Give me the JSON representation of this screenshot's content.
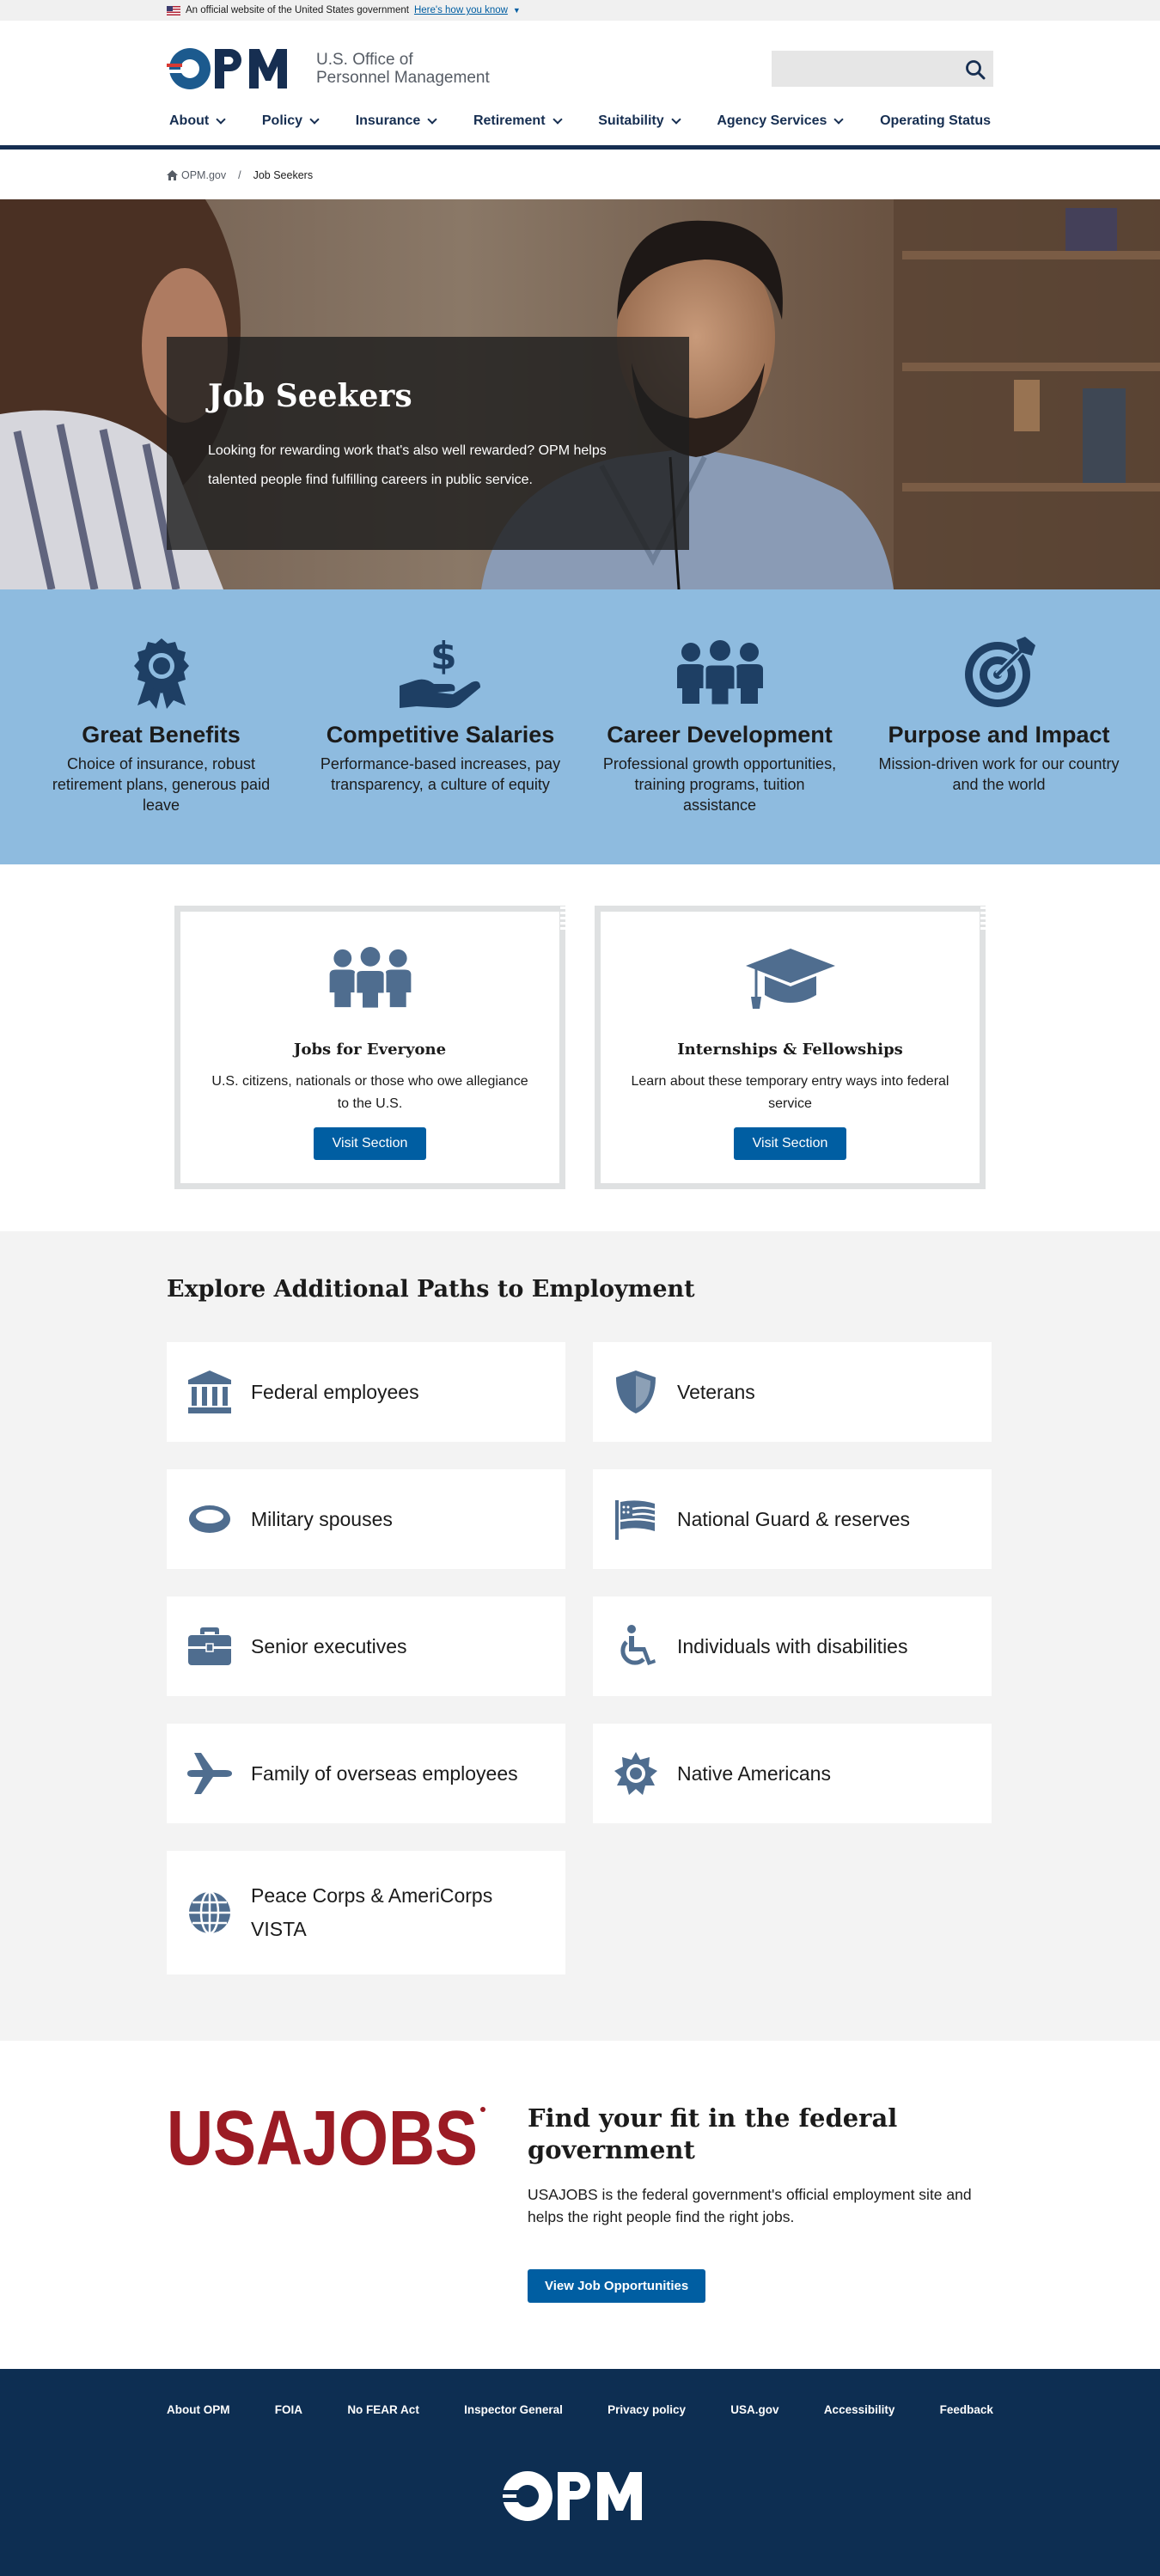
{
  "gov_banner": {
    "text": "An official website of the United States government",
    "link": "Here's how you know"
  },
  "header": {
    "logo_text_line1": "U.S. Office of",
    "logo_text_line2": "Personnel Management",
    "search_placeholder": "",
    "nav": [
      {
        "label": "About",
        "has_dropdown": true
      },
      {
        "label": "Policy",
        "has_dropdown": true
      },
      {
        "label": "Insurance",
        "has_dropdown": true
      },
      {
        "label": "Retirement",
        "has_dropdown": true
      },
      {
        "label": "Suitability",
        "has_dropdown": true
      },
      {
        "label": "Agency Services",
        "has_dropdown": true
      },
      {
        "label": "Operating Status",
        "has_dropdown": false
      }
    ]
  },
  "breadcrumb": {
    "home": "OPM.gov",
    "separator": "/",
    "current": "Job Seekers"
  },
  "hero": {
    "title": "Job Seekers",
    "text": "Looking for rewarding work that's also well rewarded? OPM helps talented people find fulfilling careers in public service."
  },
  "benefits": [
    {
      "icon": "award-ribbon-icon",
      "title": "Great Benefits",
      "text": "Choice of insurance, robust retirement plans, generous paid leave"
    },
    {
      "icon": "hand-dollar-icon",
      "title": "Competitive Salaries",
      "text": "Performance-based increases, pay transparency, a culture of equity"
    },
    {
      "icon": "people-group-icon",
      "title": "Career Development",
      "text": "Professional growth opportunities, training programs, tuition assistance"
    },
    {
      "icon": "target-icon",
      "title": "Purpose and Impact",
      "text": "Mission-driven work for our country and the world"
    }
  ],
  "cards": [
    {
      "icon": "people-group-icon",
      "title": "Jobs for Everyone",
      "text": "U.S. citizens, nationals or those who owe allegiance to the U.S.",
      "button": "Visit Section"
    },
    {
      "icon": "graduation-cap-icon",
      "title": "Internships & Fellowships",
      "text": "Learn about these temporary entry ways into federal service",
      "button": "Visit Section"
    }
  ],
  "paths": {
    "title": "Explore Additional Paths to Employment",
    "items": [
      {
        "icon": "building-columns-icon",
        "label": "Federal employees"
      },
      {
        "icon": "shield-icon",
        "label": "Veterans"
      },
      {
        "icon": "ring-icon",
        "label": "Military spouses"
      },
      {
        "icon": "flag-icon",
        "label": "National Guard & reserves"
      },
      {
        "icon": "briefcase-icon",
        "label": "Senior executives"
      },
      {
        "icon": "wheelchair-icon",
        "label": "Individuals with disabilities"
      },
      {
        "icon": "airplane-icon",
        "label": "Family of overseas employees"
      },
      {
        "icon": "sun-icon",
        "label": "Native Americans"
      },
      {
        "icon": "globe-icon",
        "label": "Peace Corps & AmeriCorps VISTA"
      }
    ]
  },
  "usajobs": {
    "logo": "USAJOBS",
    "title": "Find your fit in the federal government",
    "text": "USAJOBS is the federal government's official employment site and helps the right people find the right jobs.",
    "button": "View Job Opportunities"
  },
  "footer": {
    "links": [
      "About OPM",
      "FOIA",
      "No FEAR Act",
      "Inspector General",
      "Privacy policy",
      "USA.gov",
      "Accessibility",
      "Feedback"
    ],
    "logo": "OPM"
  },
  "colors": {
    "navy": "#162e51",
    "blue_button": "#005ea2",
    "benefits_bg": "#8ebbdf",
    "icon_slate": "#4f6d8f",
    "usajobs_red": "#9b1b24",
    "footer_bg": "#0d2e52"
  }
}
